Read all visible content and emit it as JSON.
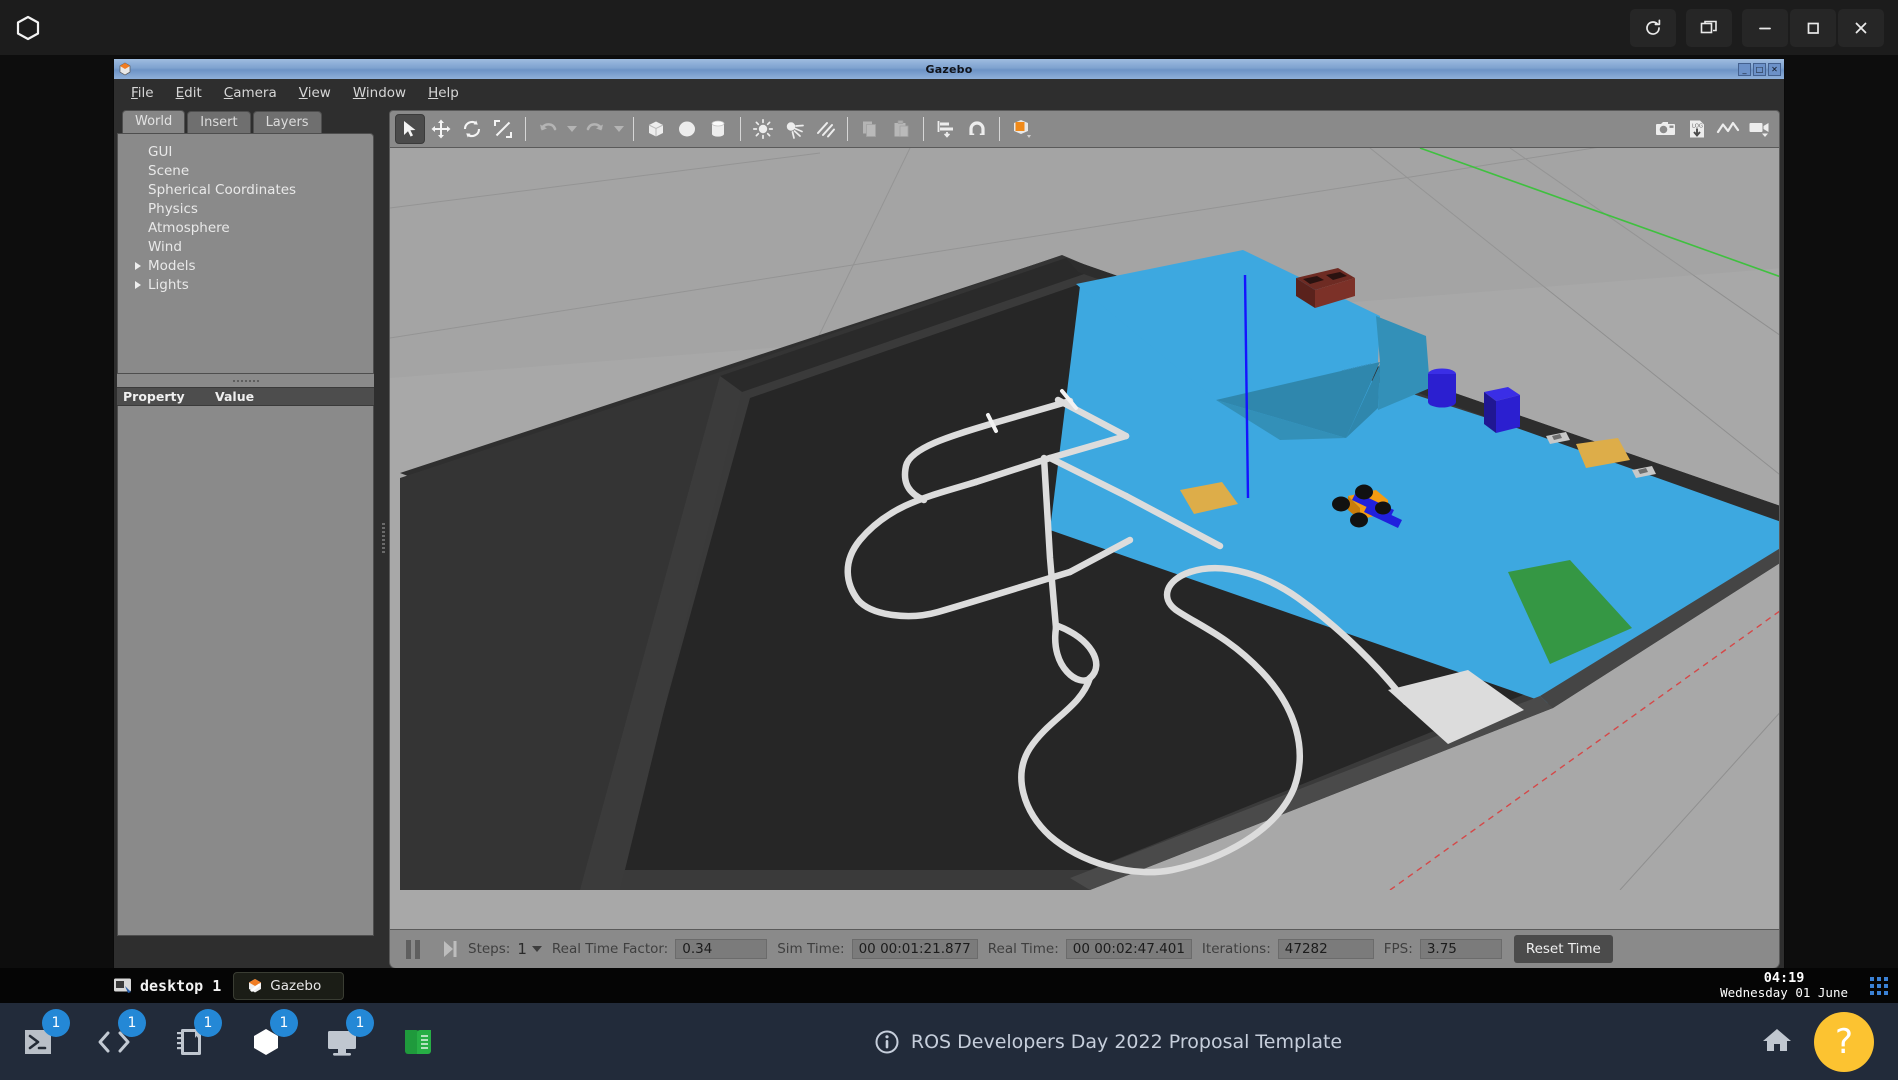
{
  "topbar": {
    "logo_icon": "cube-logo-icon",
    "buttons": [
      {
        "name": "reload-button",
        "icon": "reload-icon"
      },
      {
        "name": "windows-button",
        "icon": "windows-stack-icon"
      },
      {
        "name": "minimize-button",
        "icon": "minimize-icon"
      },
      {
        "name": "maximize-button",
        "icon": "maximize-icon"
      },
      {
        "name": "close-button",
        "icon": "close-icon"
      }
    ]
  },
  "gazebo": {
    "title": "Gazebo",
    "title_icon": "gazebo-icon",
    "window_buttons": [
      "_",
      "□",
      "✕"
    ],
    "menus": [
      {
        "label": "File",
        "mnemonic": "F"
      },
      {
        "label": "Edit",
        "mnemonic": "E"
      },
      {
        "label": "Camera",
        "mnemonic": "C"
      },
      {
        "label": "View",
        "mnemonic": "V"
      },
      {
        "label": "Window",
        "mnemonic": "W"
      },
      {
        "label": "Help",
        "mnemonic": "H"
      }
    ],
    "tabs": [
      {
        "label": "World",
        "active": true
      },
      {
        "label": "Insert",
        "active": false
      },
      {
        "label": "Layers",
        "active": false
      }
    ],
    "tree": [
      {
        "label": "GUI",
        "expandable": false
      },
      {
        "label": "Scene",
        "expandable": false
      },
      {
        "label": "Spherical Coordinates",
        "expandable": false
      },
      {
        "label": "Physics",
        "expandable": false
      },
      {
        "label": "Atmosphere",
        "expandable": false
      },
      {
        "label": "Wind",
        "expandable": false
      },
      {
        "label": "Models",
        "expandable": true
      },
      {
        "label": "Lights",
        "expandable": true
      }
    ],
    "property_table": {
      "col_property": "Property",
      "col_value": "Value",
      "rows": []
    },
    "toolbar": [
      {
        "name": "select-mode-tool",
        "icon": "cursor-arrow-icon",
        "active": true
      },
      {
        "name": "translate-mode-tool",
        "icon": "move-arrows-icon",
        "active": false
      },
      {
        "name": "rotate-mode-tool",
        "icon": "rotate-icon",
        "active": false
      },
      {
        "name": "scale-mode-tool",
        "icon": "scale-icon",
        "active": false
      },
      {
        "name": "undo-tool",
        "icon": "undo-arrow-icon",
        "active": false
      },
      {
        "name": "undo-history-tool",
        "icon": "caret-down-icon",
        "active": false
      },
      {
        "name": "redo-tool",
        "icon": "redo-arrow-icon",
        "active": false
      },
      {
        "name": "redo-history-tool",
        "icon": "caret-down-icon",
        "active": false
      },
      {
        "name": "insert-box-tool",
        "icon": "box-icon",
        "active": false
      },
      {
        "name": "insert-sphere-tool",
        "icon": "sphere-icon",
        "active": false
      },
      {
        "name": "insert-cylinder-tool",
        "icon": "cylinder-icon",
        "active": false
      },
      {
        "name": "insert-point-light-tool",
        "icon": "point-light-icon",
        "active": false
      },
      {
        "name": "insert-spot-light-tool",
        "icon": "spot-light-icon",
        "active": false
      },
      {
        "name": "insert-directional-light-tool",
        "icon": "directional-light-icon",
        "active": false
      },
      {
        "name": "copy-tool",
        "icon": "copy-icon",
        "active": false
      },
      {
        "name": "paste-tool",
        "icon": "paste-icon",
        "active": false
      },
      {
        "name": "align-tool",
        "icon": "align-icon",
        "active": false
      },
      {
        "name": "snap-tool",
        "icon": "magnet-icon",
        "active": false
      },
      {
        "name": "view-mode-tool",
        "icon": "orange-cube-icon",
        "active": false
      }
    ],
    "toolbar_right": [
      {
        "name": "screenshot-tool",
        "icon": "camera-icon"
      },
      {
        "name": "save-log-tool",
        "icon": "log-download-icon"
      },
      {
        "name": "plot-tool",
        "icon": "plot-line-icon"
      },
      {
        "name": "record-video-tool",
        "icon": "video-camera-icon"
      }
    ],
    "status": {
      "pause_button": "pause-icon",
      "step_button": "step-forward-icon",
      "steps_label": "Steps:",
      "steps_value": "1",
      "rtf_label": "Real Time Factor:",
      "rtf_value": "0.34",
      "sim_time_label": "Sim Time:",
      "sim_time_value": "00 00:01:21.877",
      "real_time_label": "Real Time:",
      "real_time_value": "00 00:02:47.401",
      "iterations_label": "Iterations:",
      "iterations_value": "47282",
      "fps_label": "FPS:",
      "fps_value": "3.75",
      "reset_button": "Reset Time"
    }
  },
  "scene": {
    "colors": {
      "ground": "#a8a8a8",
      "arena_wall": "#3a3a3a",
      "track_floor": "#262626",
      "water_blue": "#3da8e0",
      "ramp_shadow": "#3087b0",
      "lane_line": "#dcdcdc",
      "brick_red": "#7c3128",
      "obstacle_blue": "#2b1fd0",
      "patch_green": "#359744",
      "patch_yellow": "#ddad49",
      "patch_white": "#dcdcdc",
      "robot_orange": "#f59b12",
      "robot_blue": "#2020dd",
      "axis_blue": "#1414ff",
      "axis_green": "#2ec62e",
      "axis_red": "#e03030"
    }
  },
  "taskbar": {
    "desktop_icon": "desktop-window-icon",
    "desktop_label": "desktop 1",
    "task_icon": "gazebo-icon",
    "task_label": "Gazebo",
    "clock_time": "04:19",
    "clock_date": "Wednesday 01 June",
    "grid_icon": "app-grid-icon"
  },
  "dock": {
    "items": [
      {
        "name": "dock-item-terminal",
        "icon": "terminal-icon",
        "badge": "1"
      },
      {
        "name": "dock-item-code-editor",
        "icon": "code-brackets-icon",
        "badge": "1"
      },
      {
        "name": "dock-item-notebook",
        "icon": "notebook-icon",
        "badge": "1"
      },
      {
        "name": "dock-item-gazebo",
        "icon": "cube-icon",
        "badge": "1"
      },
      {
        "name": "dock-item-graphical-tools",
        "icon": "monitor-icon",
        "badge": "1"
      },
      {
        "name": "dock-item-course-notebook",
        "icon": "green-book-icon",
        "badge": ""
      }
    ],
    "center_icon": "info-circle-icon",
    "center_label": "ROS Developers Day 2022 Proposal Template",
    "home_icon": "home-icon",
    "help_label": "?"
  }
}
